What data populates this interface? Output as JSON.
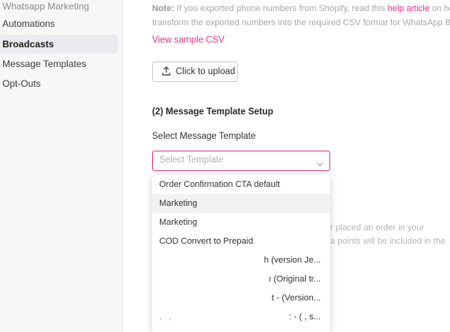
{
  "sidebar": {
    "items": [
      {
        "label": "Whatsapp Marketing"
      },
      {
        "label": "Automations"
      },
      {
        "label": "Broadcasts"
      },
      {
        "label": "Message Templates"
      },
      {
        "label": "Opt-Outs"
      }
    ]
  },
  "note": {
    "prefix": "Note:",
    "line1_a": " If you exported phone numbers from Shopify, read this ",
    "link": "help article",
    "line1_b": " on how t",
    "line2": "transform the exported numbers into the required CSV format for WhatsApp Broa"
  },
  "sample_csv_link": "View sample CSV",
  "upload_button": "Click to upload",
  "section_title": "(2) Message Template Setup",
  "select_label": "Select Message Template",
  "select_placeholder": "Select Template",
  "background_text": {
    "line1": "r placed an order in your",
    "line2": "a points will be included in the"
  },
  "dropdown": {
    "options": [
      {
        "label": "Order Confirmation CTA default"
      },
      {
        "label": "Marketing"
      },
      {
        "label": "Marketing"
      },
      {
        "label": "COD Convert to Prepaid"
      },
      {
        "label": "h (version Je..."
      },
      {
        "label": "ı (Original tr..."
      },
      {
        "label": "t - (Version..."
      },
      {
        "label": ": - (  ,  s..."
      }
    ],
    "partial_left": ",  ,"
  },
  "colors": {
    "accent": "#e0368a",
    "sidebar_bg": "#f7f7f8",
    "active_bg": "#ebebef"
  },
  "icons": {
    "upload": "upload-icon",
    "select_arrow": "chevron-down-icon"
  }
}
